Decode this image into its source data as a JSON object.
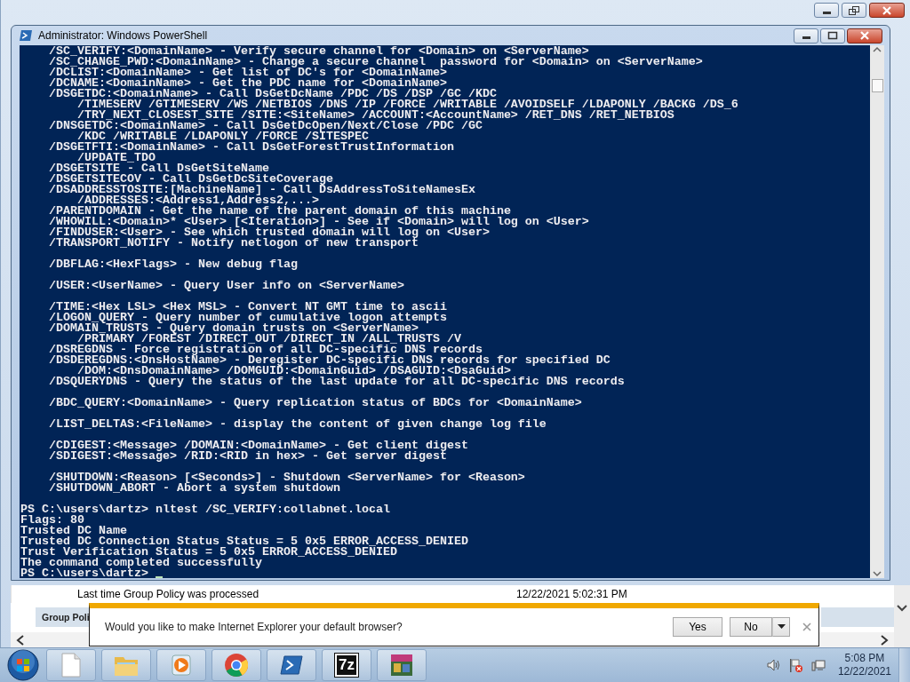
{
  "background_window": {
    "row_label": "Last time Group Policy was processed",
    "row_value": "12/22/2021 5:02:31 PM",
    "section_header": "Group Poli"
  },
  "console_window": {
    "title": "Administrator: Windows PowerShell",
    "blocks": [
      [
        "    /SC_VERIFY:<DomainName> - Verify secure channel for <Domain> on <ServerName>",
        "    /SC_CHANGE_PWD:<DomainName> - Change a secure channel  password for <Domain> on <ServerName>",
        "    /DCLIST:<DomainName> - Get list of DC's for <DomainName>",
        "    /DCNAME:<DomainName> - Get the PDC name for <DomainName>",
        "    /DSGETDC:<DomainName> - Call DsGetDcName /PDC /DS /DSP /GC /KDC",
        "        /TIMESERV /GTIMESERV /WS /NETBIOS /DNS /IP /FORCE /WRITABLE /AVOIDSELF /LDAPONLY /BACKG /DS_6",
        "        /TRY_NEXT_CLOSEST_SITE /SITE:<SiteName> /ACCOUNT:<AccountName> /RET_DNS /RET_NETBIOS",
        "    /DNSGETDC:<DomainName> - Call DsGetDcOpen/Next/Close /PDC /GC",
        "        /KDC /WRITABLE /LDAPONLY /FORCE /SITESPEC",
        "    /DSGETFTI:<DomainName> - Call DsGetForestTrustInformation",
        "        /UPDATE_TDO",
        "    /DSGETSITE - Call DsGetSiteName",
        "    /DSGETSITECOV - Call DsGetDcSiteCoverage",
        "    /DSADDRESSTOSITE:[MachineName] - Call DsAddressToSiteNamesEx",
        "        /ADDRESSES:<Address1,Address2,...>",
        "    /PARENTDOMAIN - Get the name of the parent domain of this machine",
        "    /WHOWILL:<Domain>* <User> [<Iteration>] - See if <Domain> will log on <User>",
        "    /FINDUSER:<User> - See which trusted domain will log on <User>",
        "    /TRANSPORT_NOTIFY - Notify netlogon of new transport"
      ],
      [
        "    /DBFLAG:<HexFlags> - New debug flag"
      ],
      [
        "    /USER:<UserName> - Query User info on <ServerName>"
      ],
      [
        "    /TIME:<Hex LSL> <Hex MSL> - Convert NT GMT time to ascii",
        "    /LOGON_QUERY - Query number of cumulative logon attempts",
        "    /DOMAIN_TRUSTS - Query domain trusts on <ServerName>",
        "        /PRIMARY /FOREST /DIRECT_OUT /DIRECT_IN /ALL_TRUSTS /V",
        "    /DSREGDNS - Force registration of all DC-specific DNS records",
        "    /DSDEREGDNS:<DnsHostName> - Deregister DC-specific DNS records for specified DC",
        "        /DOM:<DnsDomainName> /DOMGUID:<DomainGuid> /DSAGUID:<DsaGuid>",
        "    /DSQUERYDNS - Query the status of the last update for all DC-specific DNS records"
      ],
      [
        "    /BDC_QUERY:<DomainName> - Query replication status of BDCs for <DomainName>"
      ],
      [
        "    /LIST_DELTAS:<FileName> - display the content of given change log file"
      ],
      [
        "    /CDIGEST:<Message> /DOMAIN:<DomainName> - Get client digest",
        "    /SDIGEST:<Message> /RID:<RID in hex> - Get server digest"
      ],
      [
        "    /SHUTDOWN:<Reason> [<Seconds>] - Shutdown <ServerName> for <Reason>",
        "    /SHUTDOWN_ABORT - Abort a system shutdown"
      ],
      [
        "PS C:\\users\\dartz> nltest /SC_VERIFY:collabnet.local",
        "Flags: 80",
        "Trusted DC Name",
        "Trusted DC Connection Status Status = 5 0x5 ERROR_ACCESS_DENIED",
        "Trust Verification Status = 5 0x5 ERROR_ACCESS_DENIED",
        "The command completed successfully",
        "PS C:\\users\\dartz>"
      ]
    ]
  },
  "notification": {
    "message": "Would you like to make Internet Explorer your default browser?",
    "buttons": [
      {
        "label": "Yes",
        "kind": "plain"
      },
      {
        "label": "No",
        "kind": "split"
      }
    ]
  },
  "taskbar": {
    "apps": [
      {
        "kind": "document"
      },
      {
        "kind": "folder"
      },
      {
        "kind": "media"
      },
      {
        "kind": "browser"
      },
      {
        "kind": "shell"
      },
      {
        "kind": "archive",
        "label": "7z"
      },
      {
        "kind": "game"
      }
    ],
    "tray": [
      {
        "kind": "speaker"
      },
      {
        "kind": "flag"
      },
      {
        "kind": "network"
      }
    ],
    "clock": {
      "time": "5:08 PM",
      "date": "12/22/2021"
    }
  }
}
